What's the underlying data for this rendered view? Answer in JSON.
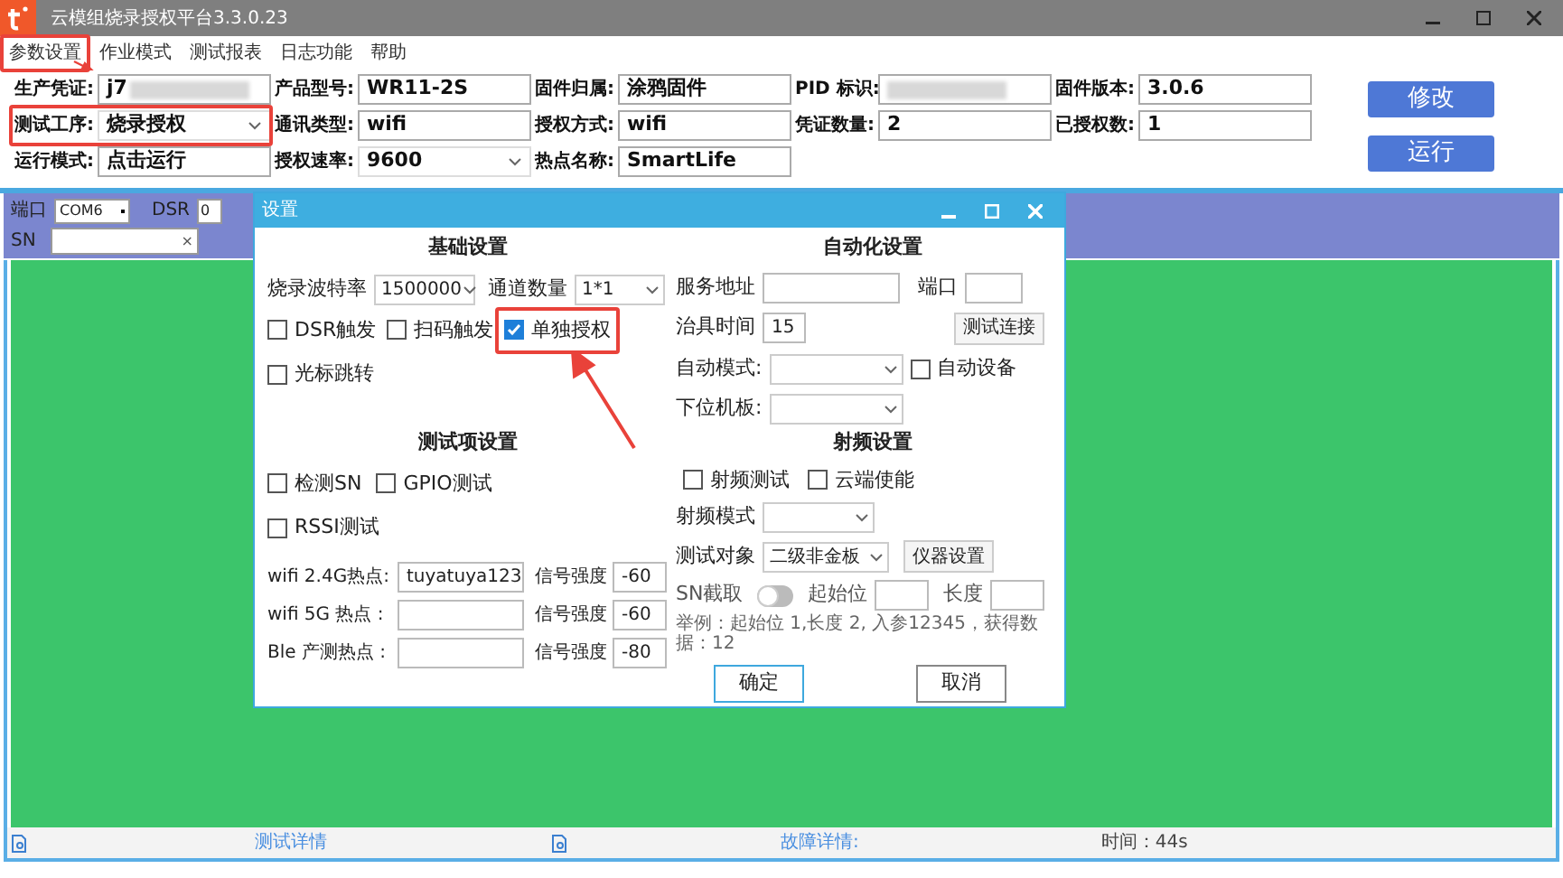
{
  "window": {
    "title": "云模组烧录授权平台3.3.0.23"
  },
  "menu": [
    {
      "label": "参数设置",
      "highlighted": true
    },
    {
      "label": "作业模式",
      "highlighted": false
    },
    {
      "label": "测试报表",
      "highlighted": false
    },
    {
      "label": "日志功能",
      "highlighted": false
    },
    {
      "label": "帮助",
      "highlighted": false
    }
  ],
  "form": {
    "rows": [
      [
        {
          "label": "生产凭证:",
          "kind": "blurred",
          "value": "j7",
          "highlighted": false
        },
        {
          "label": "产品型号:",
          "kind": "text",
          "value": "WR11-2S",
          "highlighted": false
        },
        {
          "label": "固件归属:",
          "kind": "text",
          "value": "涂鸦固件",
          "highlighted": false
        },
        {
          "label": "PID 标识:",
          "kind": "blurred",
          "highlighted": false
        },
        {
          "label": "固件版本:",
          "kind": "text",
          "value": "3.0.6",
          "highlighted": false
        }
      ],
      [
        {
          "label": "测试工序:",
          "kind": "select",
          "value": "烧录授权",
          "highlighted": true
        },
        {
          "label": "通讯类型:",
          "kind": "text",
          "value": "wifi",
          "highlighted": false
        },
        {
          "label": "授权方式:",
          "kind": "text",
          "value": "wifi",
          "highlighted": false
        },
        {
          "label": "凭证数量:",
          "kind": "text",
          "value": "2",
          "highlighted": false
        },
        {
          "label": "已授权数:",
          "kind": "text",
          "value": "1",
          "highlighted": false
        }
      ],
      [
        {
          "label": "运行模式:",
          "kind": "text",
          "value": "点击运行",
          "highlighted": false
        },
        {
          "label": "授权速率:",
          "kind": "select",
          "value": "9600",
          "highlighted": false
        },
        {
          "label": "热点名称:",
          "kind": "text",
          "value": "SmartLife",
          "highlighted": false
        }
      ]
    ]
  },
  "buttons": [
    "修改",
    "运行"
  ],
  "port_bar": {
    "port_label": "端口",
    "port": "COM6",
    "dsr_label": "DSR",
    "dsr": "0",
    "sn_label": "SN",
    "clear": "×"
  },
  "status_bar": {
    "test_details": "测试详情",
    "fault_details": "故障详情:",
    "time": "时间：44s"
  },
  "dialog": {
    "title": "设置",
    "basic": {
      "title": "基础设置",
      "baud_label": "烧录波特率",
      "baud": "1500000",
      "channels_label": "通道数量",
      "channels": "1*1",
      "checkboxes": [
        {
          "label": "DSR触发",
          "checked": false,
          "highlighted": false
        },
        {
          "label": "扫码触发",
          "checked": false,
          "highlighted": false
        },
        {
          "label": "单独授权",
          "checked": true,
          "highlighted": true
        },
        {
          "label": "光标跳转",
          "checked": false,
          "highlighted": false
        }
      ]
    },
    "tests": {
      "title": "测试项设置",
      "checkboxes": [
        {
          "label": "检测SN",
          "checked": false
        },
        {
          "label": "GPIO测试",
          "checked": false
        },
        {
          "label": "RSSI测试",
          "checked": false
        }
      ],
      "hotspots": [
        {
          "label": "wifi 2.4G热点:",
          "value": "tuyatuya123",
          "signal_label": "信号强度",
          "signal": "-60"
        },
        {
          "label": "wifi 5G 热点 :",
          "signal_label": "信号强度",
          "signal": "-60"
        },
        {
          "label": "Ble 产测热点 :",
          "signal_label": "信号强度",
          "signal": "-80"
        }
      ]
    },
    "automation": {
      "title": "自动化设置",
      "server_label": "服务地址",
      "port_label": "端口",
      "fixture_label": "治具时间",
      "fixture": "15",
      "test_connection": "测试连接",
      "auto_mode_label": "自动模式:",
      "auto_device": {
        "label": "自动设备",
        "checked": false
      },
      "board_label": "下位机板:"
    },
    "rf": {
      "title": "射频设置",
      "checkboxes": [
        {
          "label": "射频测试",
          "checked": false
        },
        {
          "label": "云端使能",
          "checked": false
        }
      ],
      "mode_label": "射频模式",
      "target_label": "测试对象",
      "target": "二级非金板",
      "instrument": "仪器设置",
      "sn_label": "SN截取",
      "sn_cut_on": false,
      "start_label": "起始位",
      "length_label": "长度",
      "example": "举例：起始位 1,长度 2, 入参12345，获得数据：12"
    },
    "buttons": [
      {
        "label": "确定",
        "focused": true
      },
      {
        "label": "取消",
        "focused": false
      }
    ]
  }
}
